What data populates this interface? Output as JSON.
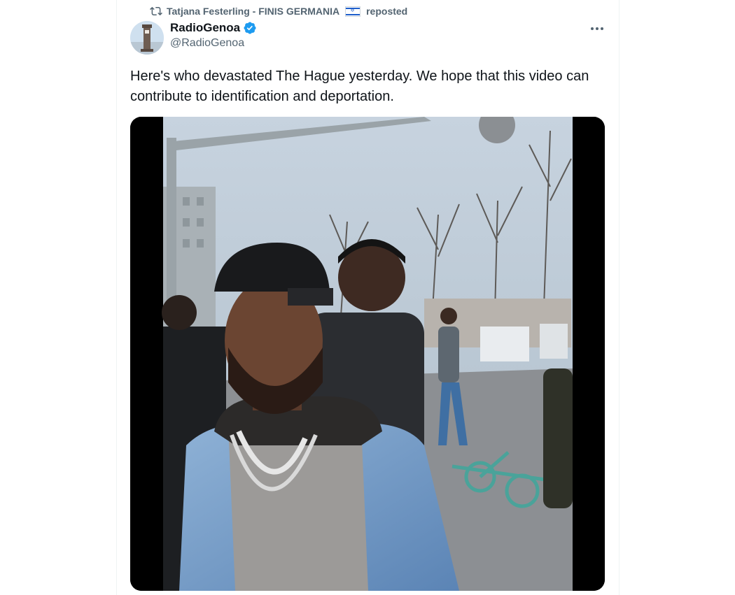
{
  "repost": {
    "icon": "repost-icon",
    "user": "Tatjana Festerling - FINIS GERMANIA",
    "flag": "israel-flag-icon",
    "action": "reposted"
  },
  "tweet": {
    "author_name": "RadioGenoa",
    "author_handle": "@RadioGenoa",
    "verified_icon": "verified-badge-icon",
    "more_icon": "more-options-icon",
    "text": "Here's who devastated The Hague yesterday. We hope that this video can contribute to identification and deportation."
  },
  "colors": {
    "text_primary": "#0f1419",
    "text_secondary": "#536471",
    "verified_blue": "#1d9bf0"
  }
}
